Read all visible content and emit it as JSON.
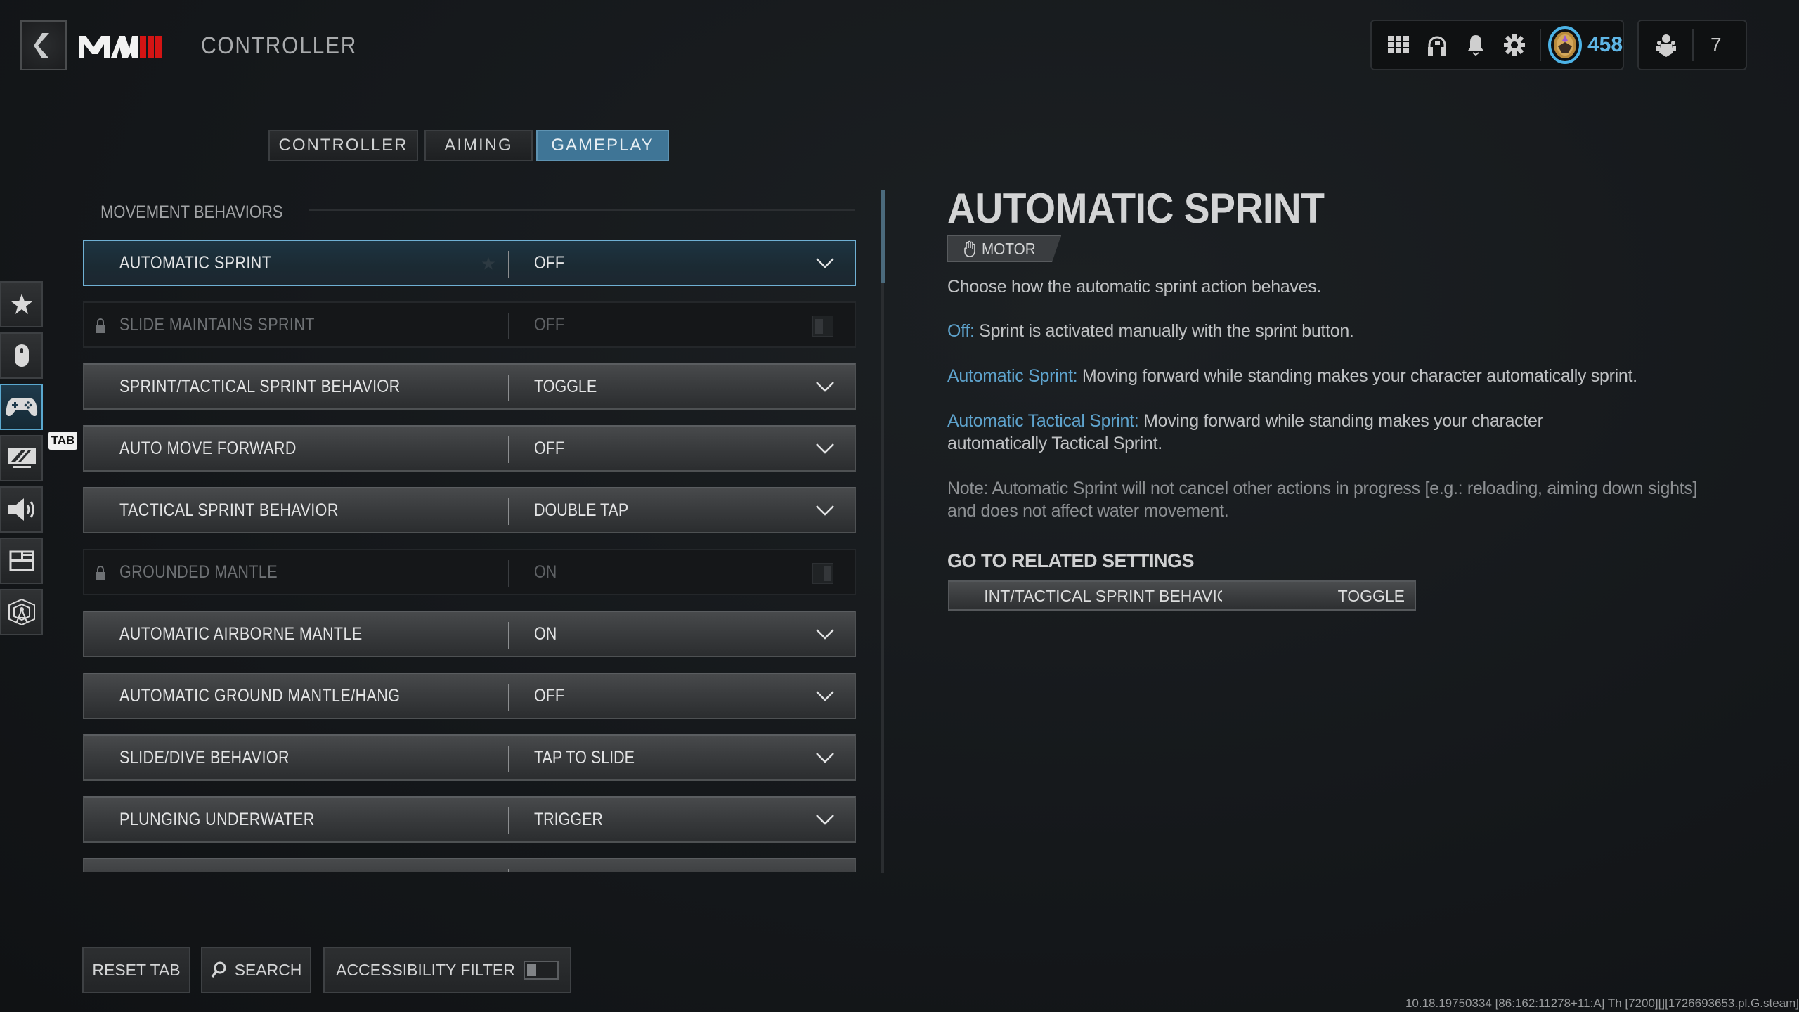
{
  "header": {
    "back_label": "Back",
    "logo_text": "MWIII",
    "title": "CONTROLLER",
    "hud": {
      "icons": [
        "grid-menu-icon",
        "headset-icon",
        "notification-bell-icon",
        "settings-gear-icon"
      ],
      "level": "458",
      "party_count": "7",
      "accent_color": "#5fb6e6"
    }
  },
  "tabs": [
    {
      "label": "CONTROLLER",
      "active": false
    },
    {
      "label": "AIMING",
      "active": false
    },
    {
      "label": "GAMEPLAY",
      "active": true
    }
  ],
  "sidebar": {
    "items": [
      {
        "name": "favorites",
        "icon": "star-icon",
        "active": false
      },
      {
        "name": "mouse-keyboard",
        "icon": "mouse-icon",
        "active": false
      },
      {
        "name": "controller",
        "icon": "gamepad-icon",
        "active": true
      },
      {
        "name": "graphics",
        "icon": "monitor-icon",
        "active": false
      },
      {
        "name": "audio",
        "icon": "speaker-icon",
        "active": false
      },
      {
        "name": "interface",
        "icon": "interface-layout-icon",
        "active": false
      },
      {
        "name": "account-network",
        "icon": "network-tower-icon",
        "active": false
      }
    ],
    "tab_hint": "TAB"
  },
  "section": {
    "title": "MOVEMENT BEHAVIORS"
  },
  "settings": [
    {
      "label": "AUTOMATIC SPRINT",
      "value": "OFF",
      "type": "dropdown",
      "selected": true,
      "locked": false
    },
    {
      "label": "SLIDE MAINTAINS SPRINT",
      "value": "OFF",
      "type": "toggle",
      "selected": false,
      "locked": true,
      "toggle_on": false
    },
    {
      "label": "SPRINT/TACTICAL SPRINT BEHAVIOR",
      "value": "TOGGLE",
      "type": "dropdown",
      "selected": false,
      "locked": false
    },
    {
      "label": "AUTO MOVE FORWARD",
      "value": "OFF",
      "type": "dropdown",
      "selected": false,
      "locked": false
    },
    {
      "label": "TACTICAL SPRINT BEHAVIOR",
      "value": "DOUBLE TAP",
      "type": "dropdown",
      "selected": false,
      "locked": false
    },
    {
      "label": "GROUNDED MANTLE",
      "value": "ON",
      "type": "toggle",
      "selected": false,
      "locked": true,
      "toggle_on": true
    },
    {
      "label": "AUTOMATIC AIRBORNE MANTLE",
      "value": "ON",
      "type": "dropdown",
      "selected": false,
      "locked": false
    },
    {
      "label": "AUTOMATIC GROUND MANTLE/HANG",
      "value": "OFF",
      "type": "dropdown",
      "selected": false,
      "locked": false
    },
    {
      "label": "SLIDE/DIVE BEHAVIOR",
      "value": "TAP TO SLIDE",
      "type": "dropdown",
      "selected": false,
      "locked": false
    },
    {
      "label": "PLUNGING UNDERWATER",
      "value": "TRIGGER",
      "type": "dropdown",
      "selected": false,
      "locked": false
    },
    {
      "label": "",
      "value": "",
      "type": "dropdown",
      "selected": false,
      "locked": false
    }
  ],
  "scroll": {
    "position_fraction": 0.0,
    "visible_fraction": 0.14
  },
  "detail": {
    "title": "AUTOMATIC SPRINT",
    "badge": "MOTOR",
    "description": "Choose how the automatic sprint action behaves.",
    "options": [
      {
        "name": "Off:",
        "text": " Sprint is activated manually with the sprint button."
      },
      {
        "name": "Automatic Sprint:",
        "text": " Moving forward while standing makes your character automatically sprint."
      },
      {
        "name": "Automatic Tactical Sprint:",
        "text": " Moving forward while standing makes your character automatically Tactical Sprint."
      }
    ],
    "note": "Note: Automatic Sprint will not cancel other actions in progress [e.g.: reloading, aiming down sights] and does not affect water movement.",
    "related_header": "GO TO RELATED SETTINGS",
    "related": {
      "label": "SPRINT/TACTICAL SPRINT BEHAVIOR",
      "value": "TOGGLE"
    },
    "highlight_color": "#5ea3cd"
  },
  "footer": {
    "reset_label": "RESET TAB",
    "search_label": "SEARCH",
    "accessibility_label": "ACCESSIBILITY FILTER",
    "accessibility_on": false,
    "build_info": "10.18.19750334 [86:162:11278+11:A] Th [7200][][1726693653.pl.G.steam]"
  }
}
